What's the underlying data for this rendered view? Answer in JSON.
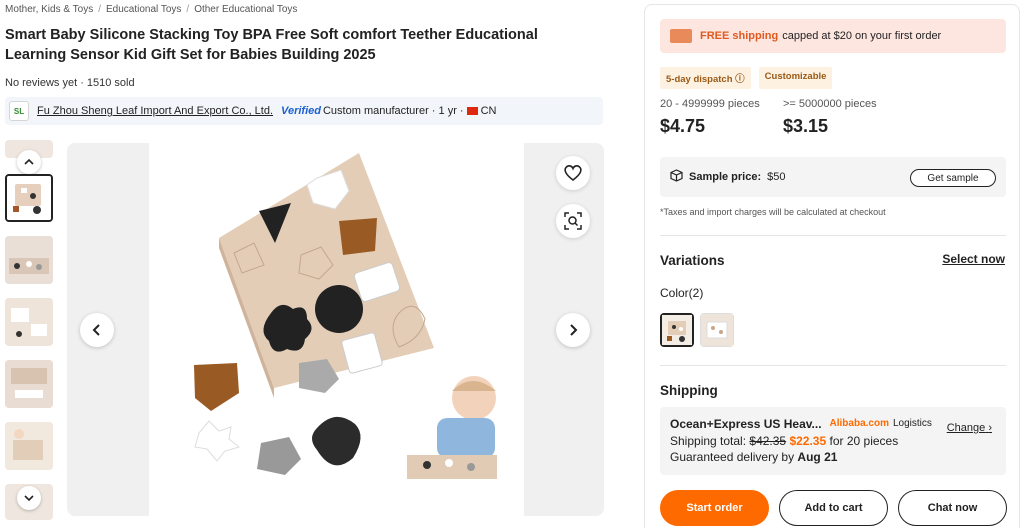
{
  "breadcrumb": [
    "Mother, Kids & Toys",
    "Educational Toys",
    "Other Educational Toys"
  ],
  "product": {
    "title": "Smart Baby Silicone Stacking Toy BPA Free Soft comfort Teether Educational Learning Sensor Kid Gift Set for Babies Building 2025",
    "reviews": "No reviews yet · 1510 sold"
  },
  "supplier": {
    "logo_text": "SL",
    "name": "Fu Zhou Sheng Leaf Import And Export Co., Ltd.",
    "verified": "Verified",
    "details": "Custom manufacturer · 1 yr ·",
    "country": "CN"
  },
  "gallery": {
    "thumb_count": 6,
    "selected_thumb": 1,
    "favorite_icon": "heart-icon",
    "search_icon": "image-search-icon"
  },
  "offer": {
    "shipping_banner": {
      "free": "FREE shipping",
      "text": "capped at $20 on your first order"
    },
    "tags": [
      "5-day dispatch ⓘ",
      "Customizable"
    ],
    "tiers": [
      {
        "qty": "20 - 4999999 pieces",
        "price": "$4.75"
      },
      {
        "qty": ">= 5000000 pieces",
        "price": "$3.15"
      }
    ],
    "sample": {
      "label": "Sample price:",
      "price": "$50",
      "button": "Get sample"
    },
    "taxes_note": "*Taxes and import charges will be calculated at checkout"
  },
  "variations": {
    "title": "Variations",
    "select_now": "Select now",
    "color_label": "Color(2)"
  },
  "shipping": {
    "title": "Shipping",
    "method": "Ocean+Express US Heav...",
    "carrier_brand": "Alibaba.com",
    "carrier_suffix": "Logistics",
    "change": "Change",
    "total_label": "Shipping total:",
    "old_price": "$42.35",
    "new_price": "$22.35",
    "pieces": "for 20 pieces",
    "guarantee_label": "Guaranteed delivery by",
    "guarantee_date": "Aug 21"
  },
  "actions": {
    "start_order": "Start order",
    "add_to_cart": "Add to cart",
    "chat_now": "Chat now"
  },
  "colors": {
    "accent": "#ff6a00",
    "banner_bg": "#fde6e0",
    "verified": "#1b5fd1"
  }
}
